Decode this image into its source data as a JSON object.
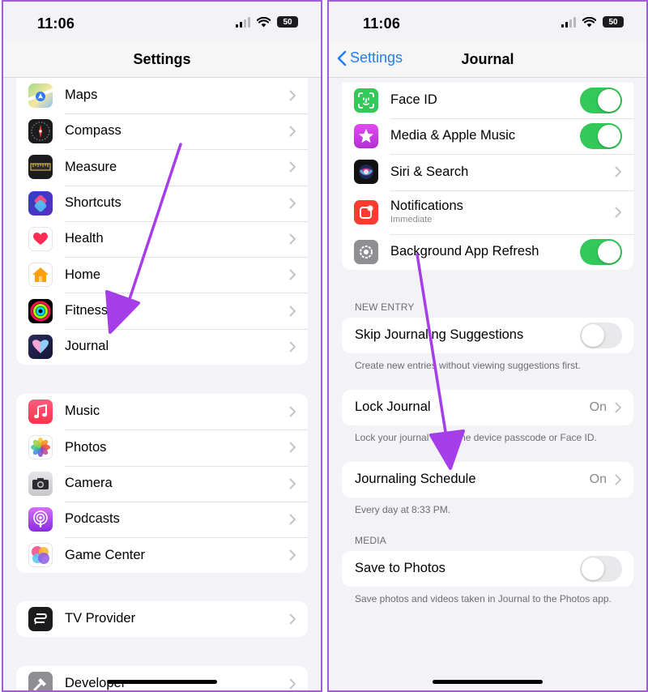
{
  "left_screen": {
    "status_time": "11:06",
    "battery": "50",
    "nav_title": "Settings",
    "group1": [
      {
        "label": "Maps",
        "icon": "maps-icon"
      },
      {
        "label": "Compass",
        "icon": "compass-icon"
      },
      {
        "label": "Measure",
        "icon": "measure-icon"
      },
      {
        "label": "Shortcuts",
        "icon": "shortcuts-icon"
      },
      {
        "label": "Health",
        "icon": "health-icon"
      },
      {
        "label": "Home",
        "icon": "home-icon"
      },
      {
        "label": "Fitness",
        "icon": "fitness-icon"
      },
      {
        "label": "Journal",
        "icon": "journal-icon"
      }
    ],
    "group2": [
      {
        "label": "Music",
        "icon": "music-icon"
      },
      {
        "label": "Photos",
        "icon": "photos-icon"
      },
      {
        "label": "Camera",
        "icon": "camera-icon"
      },
      {
        "label": "Podcasts",
        "icon": "podcasts-icon"
      },
      {
        "label": "Game Center",
        "icon": "game-center-icon"
      }
    ],
    "group3": [
      {
        "label": "TV Provider",
        "icon": "tv-provider-icon"
      }
    ],
    "group4": [
      {
        "label": "Developer",
        "icon": "developer-icon"
      }
    ]
  },
  "right_screen": {
    "status_time": "11:06",
    "battery": "50",
    "back_label": "Settings",
    "nav_title": "Journal",
    "access": [
      {
        "label": "Face ID",
        "icon": "face-id-icon",
        "toggle": true
      },
      {
        "label": "Media & Apple Music",
        "icon": "media-music-icon",
        "toggle": true
      },
      {
        "label": "Siri & Search",
        "icon": "siri-icon"
      },
      {
        "label": "Notifications",
        "sublabel": "Immediate",
        "icon": "notifications-icon"
      },
      {
        "label": "Background App Refresh",
        "icon": "background-refresh-icon",
        "toggle": true
      }
    ],
    "new_entry_header": "NEW ENTRY",
    "skip_label": "Skip Journaling Suggestions",
    "skip_on": false,
    "skip_footer": "Create new entries without viewing suggestions first.",
    "lock_label": "Lock Journal",
    "lock_value": "On",
    "lock_footer": "Lock your journal using the device passcode or Face ID.",
    "schedule_label": "Journaling Schedule",
    "schedule_value": "On",
    "schedule_footer": "Every day at 8:33 PM.",
    "media_header": "MEDIA",
    "save_photos_label": "Save to Photos",
    "save_photos_on": false,
    "save_photos_footer": "Save photos and videos taken in Journal to the Photos app."
  },
  "colors": {
    "accent_blue": "#1f7ff5",
    "toggle_green": "#34c759",
    "annotation_arrow": "#a53ee8",
    "frame_border": "#a35bd6"
  }
}
